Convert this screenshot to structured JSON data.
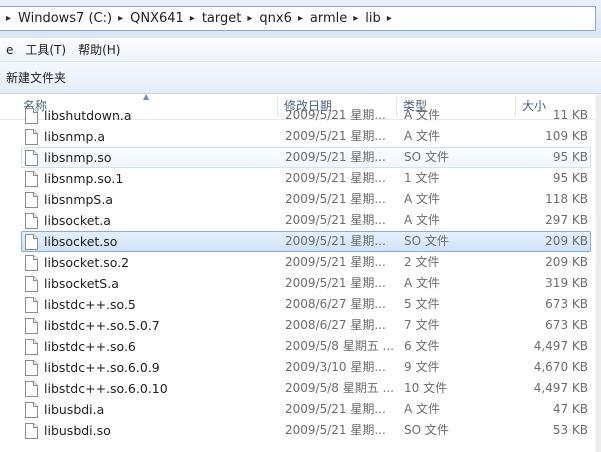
{
  "address": {
    "crumbs": [
      "Windows7 (C:)",
      "QNX641",
      "target",
      "qnx6",
      "armle",
      "lib"
    ]
  },
  "menu": {
    "items": [
      "e",
      "工具(T)",
      "帮助(H)"
    ]
  },
  "toolbar": {
    "new_folder": "新建文件夹"
  },
  "columns": {
    "name": "名称",
    "date": "修改日期",
    "type": "类型",
    "size": "大小"
  },
  "files": [
    {
      "name": "libshutdown.a",
      "date": "2009/5/21 星期...",
      "type": "A 文件",
      "size": "11 KB"
    },
    {
      "name": "libsnmp.a",
      "date": "2009/5/21 星期...",
      "type": "A 文件",
      "size": "109 KB"
    },
    {
      "name": "libsnmp.so",
      "date": "2009/5/21 星期...",
      "type": "SO 文件",
      "size": "95 KB"
    },
    {
      "name": "libsnmp.so.1",
      "date": "2009/5/21 星期...",
      "type": "1 文件",
      "size": "95 KB"
    },
    {
      "name": "libsnmpS.a",
      "date": "2009/5/21 星期...",
      "type": "A 文件",
      "size": "118 KB"
    },
    {
      "name": "libsocket.a",
      "date": "2009/5/21 星期...",
      "type": "A 文件",
      "size": "297 KB"
    },
    {
      "name": "libsocket.so",
      "date": "2009/5/21 星期...",
      "type": "SO 文件",
      "size": "209 KB"
    },
    {
      "name": "libsocket.so.2",
      "date": "2009/5/21 星期...",
      "type": "2 文件",
      "size": "209 KB"
    },
    {
      "name": "libsocketS.a",
      "date": "2009/5/21 星期...",
      "type": "A 文件",
      "size": "319 KB"
    },
    {
      "name": "libstdc++.so.5",
      "date": "2008/6/27 星期...",
      "type": "5 文件",
      "size": "673 KB"
    },
    {
      "name": "libstdc++.so.5.0.7",
      "date": "2008/6/27 星期...",
      "type": "7 文件",
      "size": "673 KB"
    },
    {
      "name": "libstdc++.so.6",
      "date": "2009/5/8 星期五 ...",
      "type": "6 文件",
      "size": "4,497 KB"
    },
    {
      "name": "libstdc++.so.6.0.9",
      "date": "2009/3/10 星期...",
      "type": "9 文件",
      "size": "4,670 KB"
    },
    {
      "name": "libstdc++.so.6.0.10",
      "date": "2009/5/8 星期五 ...",
      "type": "10 文件",
      "size": "4,497 KB"
    },
    {
      "name": "libusbdi.a",
      "date": "2009/5/21 星期...",
      "type": "A 文件",
      "size": "47 KB"
    },
    {
      "name": "libusbdi.so",
      "date": "2009/5/21 星期...",
      "type": "SO 文件",
      "size": "53 KB"
    }
  ],
  "state": {
    "hover_file": "libsnmp.so",
    "selected_file": "libsocket.so"
  },
  "colors": {
    "selection_border": "#84acdd",
    "hover_border": "#cfe3f7",
    "header_text": "#4c607a"
  }
}
